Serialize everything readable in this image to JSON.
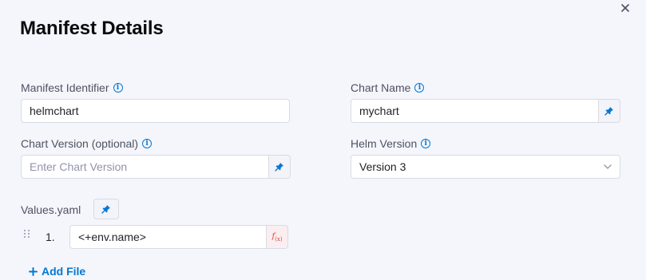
{
  "dialog": {
    "title": "Manifest Details",
    "close_icon": "close-icon"
  },
  "fields": {
    "manifest_identifier": {
      "label": "Manifest Identifier",
      "value": "helmchart"
    },
    "chart_name": {
      "label": "Chart Name",
      "value": "mychart"
    },
    "chart_version": {
      "label": "Chart Version (optional)",
      "value": "",
      "placeholder": "Enter Chart Version"
    },
    "helm_version": {
      "label": "Helm Version",
      "selected": "Version 3"
    }
  },
  "values_yaml": {
    "label": "Values.yaml",
    "items": [
      {
        "index": "1.",
        "value": "<+env.name>"
      }
    ],
    "add_file_label": "Add File"
  },
  "colors": {
    "accent": "#0278d5",
    "expression": "#e0462e",
    "background": "#f4f6fb"
  }
}
